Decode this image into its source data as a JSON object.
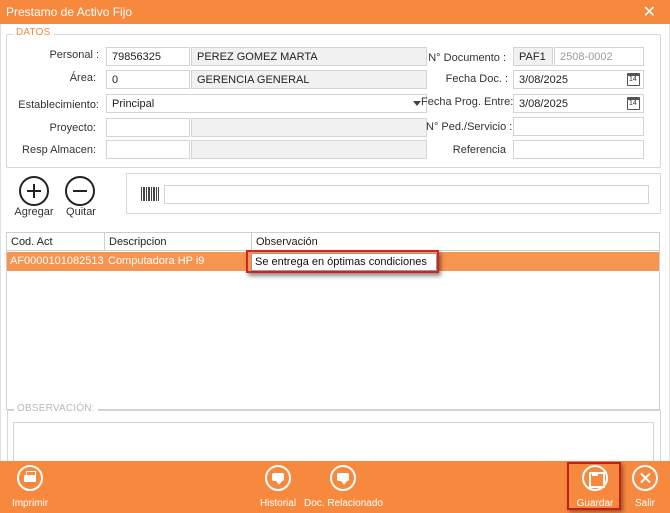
{
  "window": {
    "title": "Prestamo de Activo Fijo"
  },
  "datos": {
    "legend": "DATOS",
    "personal": {
      "label": "Personal :",
      "code": "79856325",
      "name": "PEREZ GOMEZ MARTA"
    },
    "area": {
      "label": "Área:",
      "code": "0",
      "name": "GERENCIA GENERAL"
    },
    "establecimiento": {
      "label": "Establecimiento:",
      "value": "Principal"
    },
    "proyecto": {
      "label": "Proyecto:",
      "code": "",
      "name": ""
    },
    "resp_almacen": {
      "label": "Resp Almacen:",
      "code": "",
      "name": ""
    },
    "n_documento": {
      "label": "N° Documento :",
      "serie": "PAF1",
      "numero": "2508-0002"
    },
    "fecha_doc": {
      "label": "Fecha Doc. :",
      "value": "3/08/2025"
    },
    "fecha_prog_entre": {
      "label": "Fecha Prog. Entre:",
      "value": "3/08/2025"
    },
    "n_ped_servicio": {
      "label": "N° Ped./Servicio :",
      "value": ""
    },
    "referencia": {
      "label": "Referencia",
      "value": ""
    }
  },
  "actions": {
    "agregar": "Agregar",
    "quitar": "Quitar"
  },
  "barcode": {
    "value": ""
  },
  "grid": {
    "columns": [
      "Cod. Act",
      "Descripcion",
      "Observación"
    ],
    "rows": [
      {
        "cod_act": "AF0000101082513",
        "descripcion": "Computadora HP i9",
        "observacion": "Se entrega en óptimas condiciones"
      }
    ]
  },
  "observacion": {
    "legend": "OBSERVACIÓN:",
    "value": ""
  },
  "footer": {
    "imprimir": "Imprimir",
    "historial": "Historial",
    "doc_relacionado": "Doc. Relacionado",
    "guardar": "Guardar",
    "salir": "Salir"
  },
  "colors": {
    "accent": "#f7893f",
    "row_selected": "#f7944f",
    "highlight": "#d32424"
  }
}
